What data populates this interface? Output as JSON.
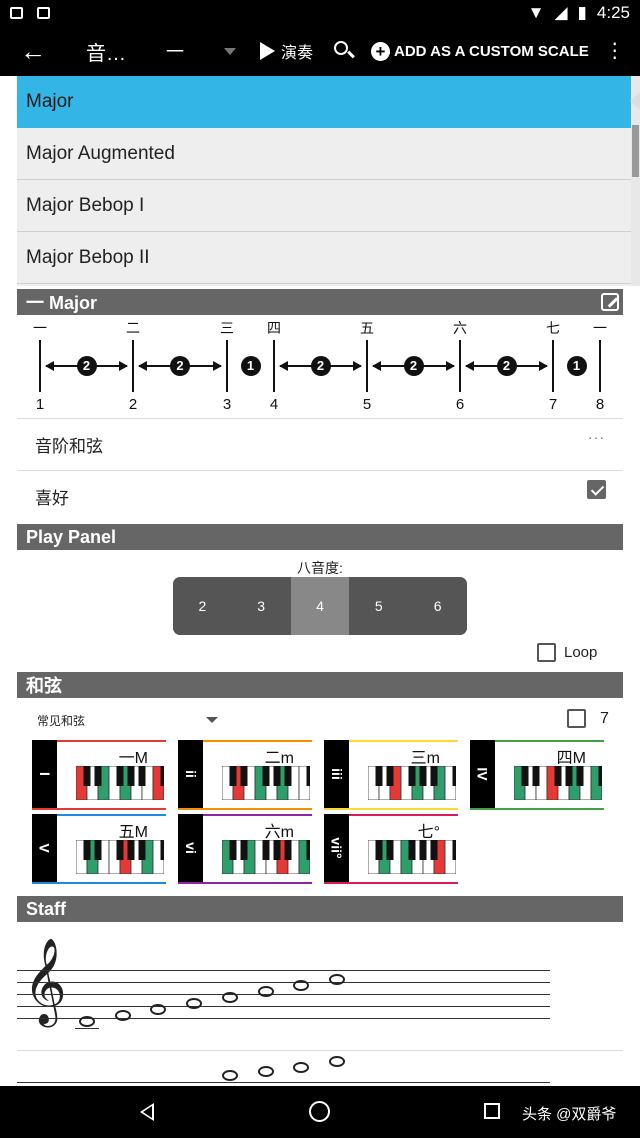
{
  "status_bar": {
    "time": "4:25"
  },
  "app_bar": {
    "title": "音阶",
    "title_display": "音…",
    "selector_value": "一",
    "play_label": "演奏",
    "add_custom_label": "ADD AS A CUSTOM SCALE"
  },
  "scale_list": {
    "items": [
      "Major",
      "Major Augmented",
      "Major Bebop I",
      "Major Bebop II"
    ],
    "selected_index": 0
  },
  "scale_section": {
    "title": "一 Major",
    "degree_labels": [
      "一",
      "二",
      "三",
      "四",
      "五",
      "六",
      "七",
      "一"
    ],
    "numbers": [
      "1",
      "2",
      "3",
      "4",
      "5",
      "6",
      "7",
      "8"
    ],
    "steps": [
      "2",
      "2",
      "1",
      "2",
      "2",
      "2",
      "1"
    ]
  },
  "rows": {
    "scale_chords": "音阶和弦",
    "scale_chords_more": "···",
    "favorites": "喜好",
    "favorites_checked": true
  },
  "play_panel": {
    "title": "Play Panel",
    "octave_label": "八音度:",
    "octaves": [
      "2",
      "3",
      "4",
      "5",
      "6"
    ],
    "selected_octave": "4",
    "loop_label": "Loop",
    "loop_checked": false
  },
  "chords": {
    "title": "和弦",
    "dropdown_value": "常见和弦",
    "seventh_label": "7",
    "seventh_checked": false,
    "cards": [
      {
        "roman": "I",
        "name": "一M",
        "color": "#e53935"
      },
      {
        "roman": "ii",
        "name": "二m",
        "color": "#fb8c00"
      },
      {
        "roman": "iii",
        "name": "三m",
        "color": "#fdd835"
      },
      {
        "roman": "IV",
        "name": "四M",
        "color": "#43a047"
      },
      {
        "roman": "V",
        "name": "五M",
        "color": "#1e88e5"
      },
      {
        "roman": "vi",
        "name": "六m",
        "color": "#8e24aa"
      },
      {
        "roman": "vii°",
        "name": "七°",
        "color": "#d81b60"
      }
    ]
  },
  "staff": {
    "title": "Staff"
  },
  "watermark": "头条 @双爵爷",
  "colors": {
    "accent": "#33b5e5",
    "header": "#666666",
    "key_highlight": "#2e9e6b",
    "root_key": "#e53935"
  }
}
